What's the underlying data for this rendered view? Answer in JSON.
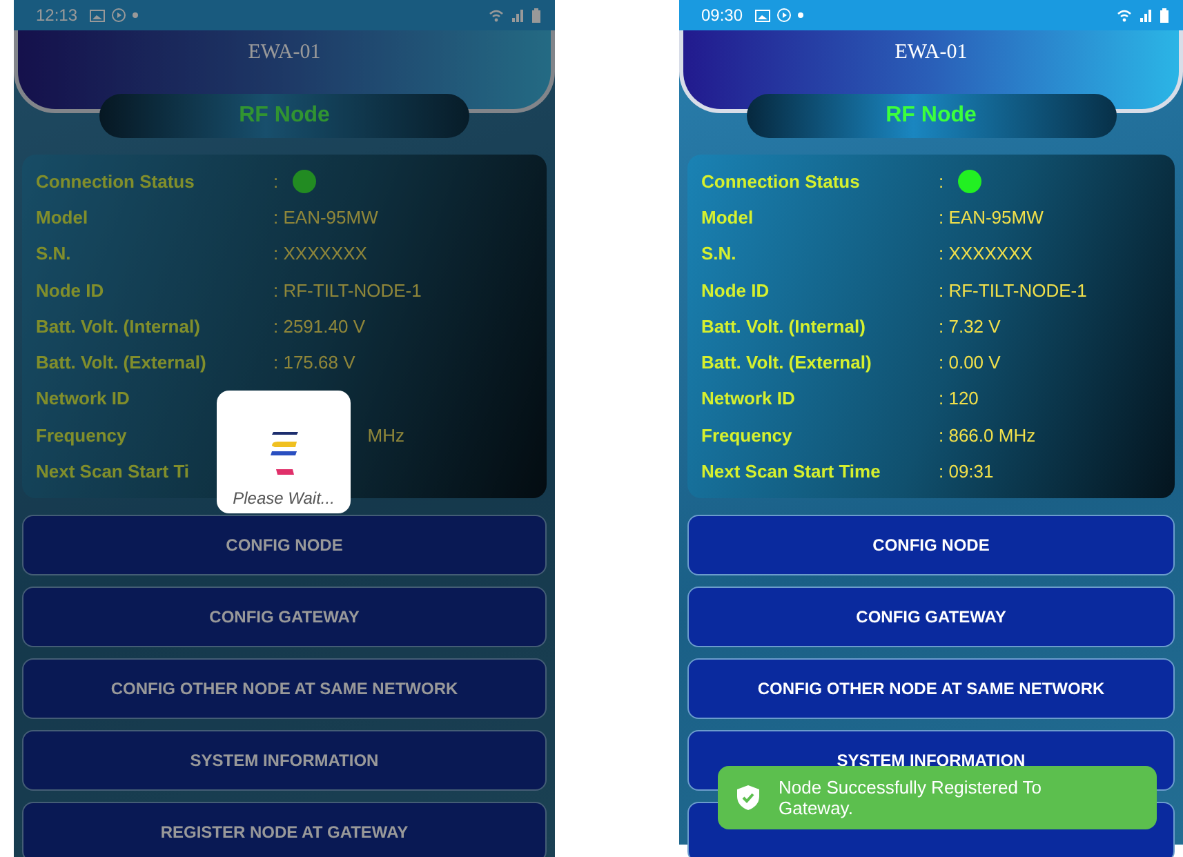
{
  "phones": [
    {
      "dimmed": true,
      "status_bar": {
        "time": "12:13"
      },
      "header": {
        "title": "EWA-01"
      },
      "node_title": "RF Node",
      "info": [
        {
          "label": "Connection Status",
          "value": ":",
          "kind": "status",
          "connected": true
        },
        {
          "label": "Model",
          "value": ": EAN-95MW",
          "kind": "text"
        },
        {
          "label": "S.N.",
          "value": ": XXXXXXX",
          "kind": "text"
        },
        {
          "label": "Node ID",
          "value": ": RF-TILT-NODE-1",
          "kind": "text"
        },
        {
          "label": "Batt. Volt. (Internal)",
          "value": ": 2591.40 V",
          "kind": "text"
        },
        {
          "label": "Batt. Volt. (External)",
          "value": ": 175.68 V",
          "kind": "text"
        },
        {
          "label": "Network ID",
          "kind": "text"
        },
        {
          "label": "Frequency",
          "value": "MHz",
          "kind": "text",
          "clipped": true
        },
        {
          "label": "Next Scan Start Ti",
          "kind": "text"
        }
      ],
      "buttons": [
        {
          "label": "CONFIG NODE"
        },
        {
          "label": "CONFIG GATEWAY"
        },
        {
          "label": "CONFIG OTHER NODE AT SAME NETWORK"
        },
        {
          "label": "SYSTEM INFORMATION"
        },
        {
          "label": "REGISTER NODE AT GATEWAY"
        }
      ],
      "loading": {
        "text": "Please Wait..."
      }
    },
    {
      "dimmed": false,
      "status_bar": {
        "time": "09:30"
      },
      "header": {
        "title": "EWA-01"
      },
      "node_title": "RF Node",
      "info": [
        {
          "label": "Connection Status",
          "value": ":",
          "kind": "status",
          "connected": true
        },
        {
          "label": "Model",
          "value": ": EAN-95MW",
          "kind": "text"
        },
        {
          "label": "S.N.",
          "value": ": XXXXXXX",
          "kind": "text"
        },
        {
          "label": "Node ID",
          "value": ": RF-TILT-NODE-1",
          "kind": "text"
        },
        {
          "label": "Batt. Volt. (Internal)",
          "value": ": 7.32 V",
          "kind": "text"
        },
        {
          "label": "Batt. Volt. (External)",
          "value": ": 0.00 V",
          "kind": "text"
        },
        {
          "label": "Network ID",
          "value": ": 120",
          "kind": "text"
        },
        {
          "label": "Frequency",
          "value": ": 866.0 MHz",
          "kind": "text"
        },
        {
          "label": "Next Scan Start Time",
          "value": ": 09:31",
          "kind": "text"
        }
      ],
      "buttons": [
        {
          "label": "CONFIG NODE"
        },
        {
          "label": "CONFIG GATEWAY"
        },
        {
          "label": "CONFIG OTHER NODE AT SAME NETWORK"
        },
        {
          "label": "SYSTEM INFORMATION"
        }
      ],
      "toast": {
        "text": "Node Successfully Registered To Gateway.",
        "over_button": true
      }
    }
  ]
}
